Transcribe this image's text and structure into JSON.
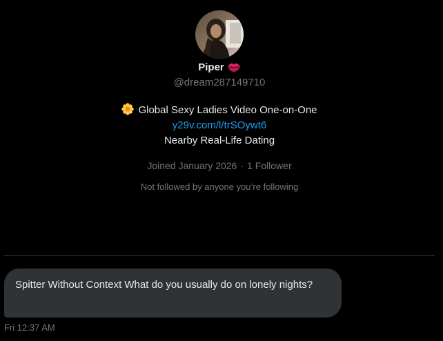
{
  "profile": {
    "name": "Piper",
    "name_emoji": "lips-icon",
    "handle": "@dream287149710",
    "bio": {
      "line1_text": "Global Sexy Ladies Video One-on-One",
      "line1_emoji": "flower-icon",
      "link": "y29v.com/l/trSOywt6",
      "line3": "Nearby Real-Life Dating"
    },
    "joined": "Joined January 2026",
    "separator": "·",
    "followers": "1 Follower",
    "not_followed": "Not followed by anyone you’re following"
  },
  "conversation": {
    "messages": [
      {
        "text": "Spitter Without Context What do you usually do on lonely nights?",
        "timestamp": "Fri 12:37 AM"
      }
    ]
  },
  "colors": {
    "background": "#000000",
    "primary_text": "#e7e9ea",
    "secondary_text": "#71767b",
    "link": "#1d9bf0",
    "bubble": "#2f3336",
    "divider": "#2f3336"
  }
}
